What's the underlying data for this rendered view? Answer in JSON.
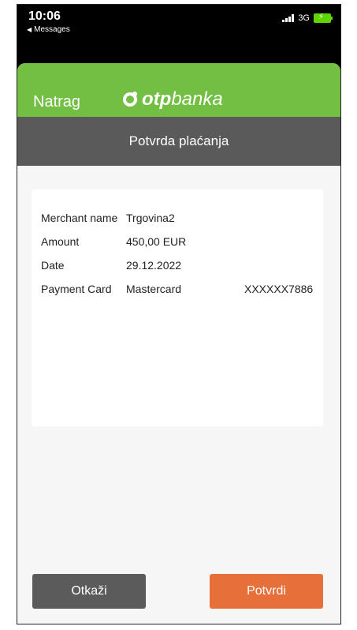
{
  "status_bar": {
    "time": "10:06",
    "back_app": "Messages",
    "network": "3G"
  },
  "header": {
    "back_label": "Natrag",
    "logo_bold": "otp",
    "logo_light": "banka",
    "subtitle": "Potvrda plaćanja"
  },
  "details": {
    "rows": [
      {
        "label": "Merchant name",
        "value": "Trgovina2"
      },
      {
        "label": "Amount",
        "value": "450,00 EUR"
      },
      {
        "label": "Date",
        "value": "29.12.2022"
      },
      {
        "label": "Payment Card",
        "value": "Mastercard",
        "extra": "XXXXXX7886"
      }
    ]
  },
  "actions": {
    "cancel_label": "Otkaži",
    "confirm_label": "Potvrdi"
  },
  "colors": {
    "green": "#72bf44",
    "subheader": "#5a5a5a",
    "cancel": "#5b5b5b",
    "confirm": "#e7703a"
  }
}
